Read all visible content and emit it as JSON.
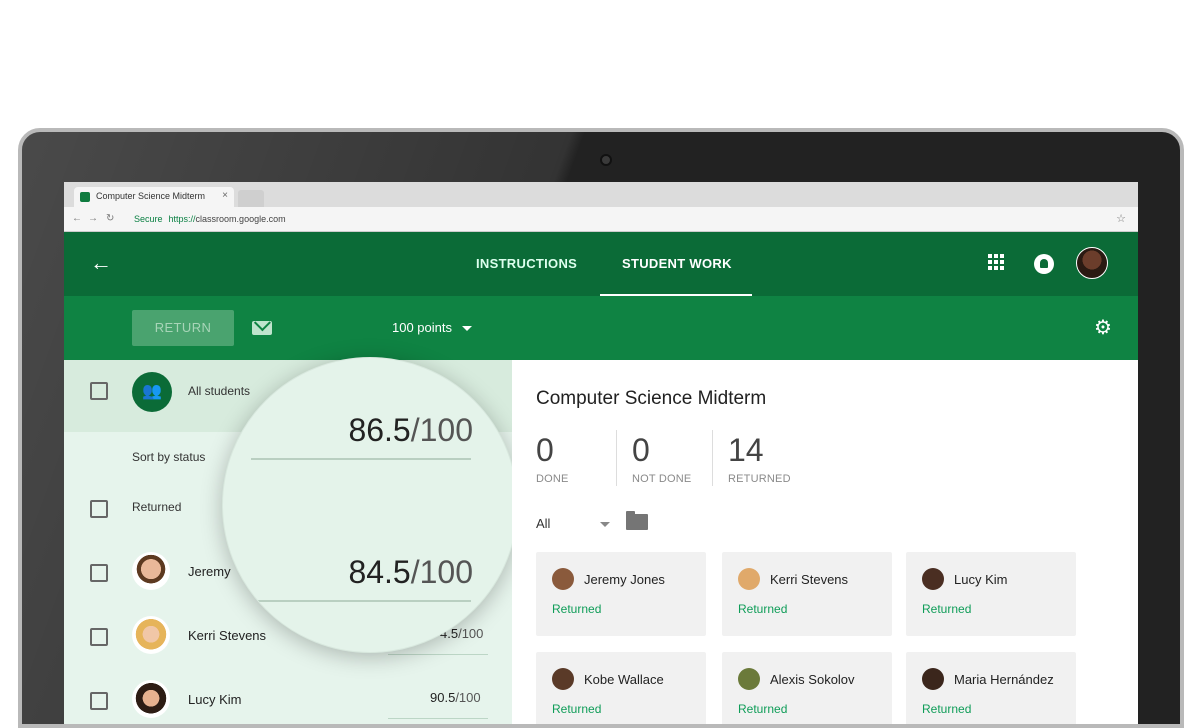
{
  "browser": {
    "tab_title": "Computer Science Midterm",
    "tab_close": "×",
    "secure_label": "Secure",
    "url_scheme": "https://",
    "url_host": "classroom.google.com"
  },
  "appbar": {
    "tabs": [
      {
        "label": "INSTRUCTIONS",
        "active": false
      },
      {
        "label": "STUDENT WORK",
        "active": true
      }
    ]
  },
  "toolbar": {
    "return_label": "RETURN",
    "points_label": "100 points"
  },
  "left_panel": {
    "all_students_label": "All students",
    "sort_label": "Sort by status",
    "group_label": "Returned",
    "students": [
      {
        "name": "Jeremy",
        "score": "",
        "denominator": ""
      },
      {
        "name": "Kerri Stevens",
        "score": "4.5",
        "denominator": "/100"
      },
      {
        "name": "Lucy Kim",
        "score": "90.5",
        "denominator": "/100"
      }
    ]
  },
  "magnifier": {
    "scores": [
      {
        "score": "86.5",
        "denominator": "/100"
      },
      {
        "score": "84.5",
        "denominator": "/100"
      }
    ]
  },
  "right_panel": {
    "title": "Computer Science Midterm",
    "stats": [
      {
        "value": "0",
        "label": "DONE"
      },
      {
        "value": "0",
        "label": "NOT DONE"
      },
      {
        "value": "14",
        "label": "RETURNED"
      }
    ],
    "filter_label": "All",
    "cards": [
      {
        "name": "Jeremy Jones",
        "status": "Returned"
      },
      {
        "name": "Kerri Stevens",
        "status": "Returned"
      },
      {
        "name": "Lucy Kim",
        "status": "Returned"
      },
      {
        "name": "Kobe Wallace",
        "status": "Returned"
      },
      {
        "name": "Alexis Sokolov",
        "status": "Returned"
      },
      {
        "name": "Maria Hernández",
        "status": "Returned"
      }
    ]
  },
  "colors": {
    "appbar": "#0b6b37",
    "toolbar": "#0f8343",
    "left_panel": "#e6f4ec",
    "status_green": "#0f9d58"
  }
}
